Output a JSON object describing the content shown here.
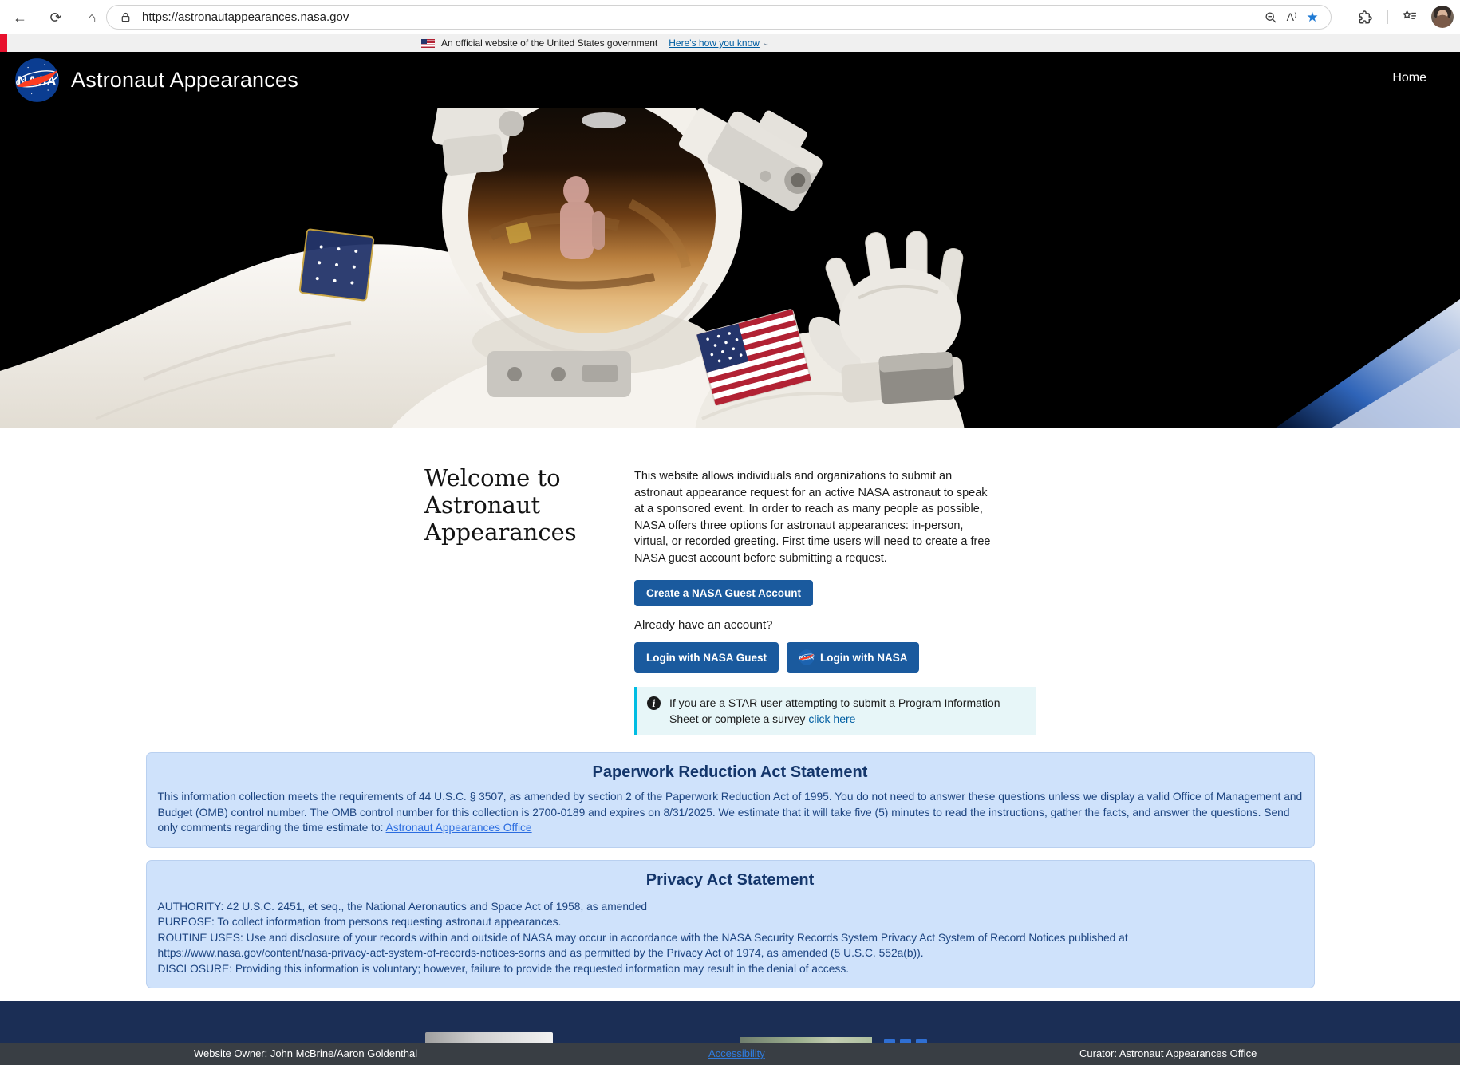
{
  "browser": {
    "url": "https://astronautappearances.nasa.gov",
    "icons": {
      "back": "←",
      "refresh": "⟳",
      "home": "⌂",
      "favorite_star": "★",
      "read_aloud": "A⁾"
    }
  },
  "gov_banner": {
    "text": "An official website of the United States government",
    "link_label": "Here's how you know",
    "chevron": "⌄"
  },
  "header": {
    "brand": "Astronaut Appearances",
    "home_link": "Home"
  },
  "welcome": {
    "heading": "Welcome to Astronaut Appearances",
    "intro": "This website allows individuals and organizations to submit an astronaut appearance request for an active NASA astronaut to speak at a sponsored event. In order to reach as many people as possible, NASA offers three options for astronaut appearances: in-person, virtual, or recorded greeting. First time users will need to create a free NASA guest account before submitting a request.",
    "create_account_button": "Create a NASA Guest Account",
    "already_have_account": "Already have an account?",
    "login_guest_button": "Login with NASA Guest",
    "login_nasa_button": "Login with NASA",
    "info_text": "If you are a STAR user attempting to submit a Program Information Sheet or complete a survey ",
    "info_link": "click here"
  },
  "paperwork_act": {
    "heading": "Paperwork Reduction Act Statement",
    "body": "This information collection meets the requirements of 44 U.S.C. § 3507, as amended by section 2 of the Paperwork Reduction Act of 1995. You do not need to answer these questions unless we display a valid Office of Management and Budget (OMB) control number. The OMB control number for this collection is 2700-0189 and expires on 8/31/2025. We estimate that it will take five (5) minutes to read the instructions, gather the facts, and answer the questions. Send only comments regarding the time estimate to: ",
    "link": "Astronaut Appearances Office"
  },
  "privacy_act": {
    "heading": "Privacy Act Statement",
    "lines": [
      "AUTHORITY: 42 U.S.C. 2451, et seq., the National Aeronautics and Space Act of 1958, as amended",
      "PURPOSE: To collect information from persons requesting astronaut appearances.",
      "ROUTINE USES: Use and disclosure of your records within and outside of NASA may occur in accordance with the NASA Security Records System Privacy Act System of Record Notices published at https://www.nasa.gov/content/nasa-privacy-act-system-of-records-notices-sorns and as permitted by the Privacy Act of 1974, as amended (5 U.S.C. 552a(b)).",
      "DISCLOSURE: Providing this information is voluntary; however, failure to provide the requested information may result in the denial of access."
    ]
  },
  "footer": {
    "website_owner": "Website Owner: John McBrine/Aaron Goldenthal",
    "accessibility_link": "Accessibility",
    "curator": "Curator: Astronaut Appearances Office"
  },
  "colors": {
    "nasa-blue": "#0b3d91",
    "nasa-red": "#fc3d21",
    "btn-blue": "#1a5a9e",
    "card-bg": "#cfe2fb",
    "card-text": "#1c4480",
    "card-heading": "#14366b",
    "info-bg": "#e7f6f8",
    "info-border": "#00bde3",
    "link-blue": "#005ea2",
    "bright-link": "#2a6ce0",
    "footer-navy": "#1b2e55",
    "footer-gray": "#393e44",
    "banner-bg": "#f0f0f0",
    "banner-red": "#e8112d",
    "star-blue": "#1f7ad4"
  }
}
